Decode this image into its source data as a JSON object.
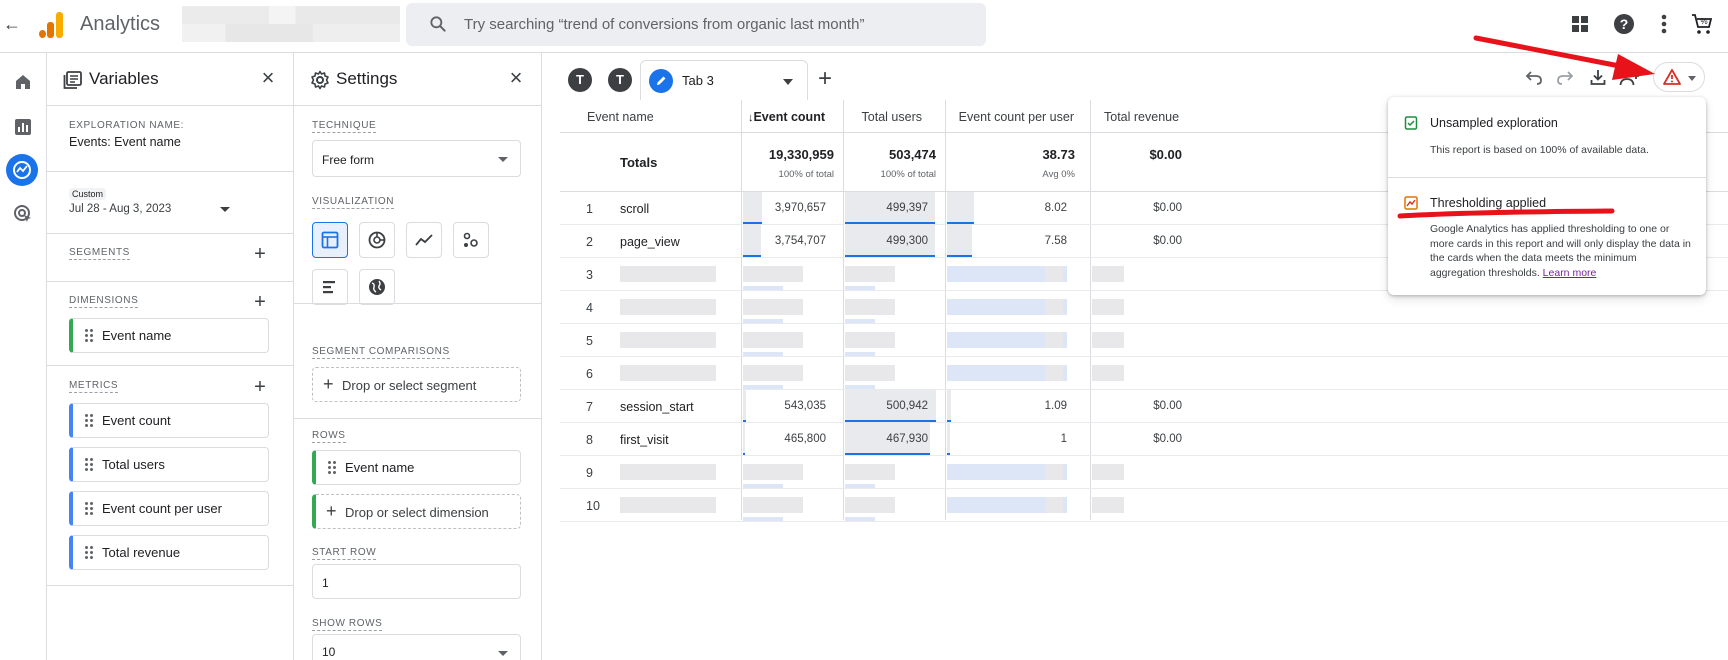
{
  "app": {
    "title": "Analytics",
    "search_placeholder": "Try searching “trend of conversions from organic last month”"
  },
  "variables_panel": {
    "title": "Variables",
    "exploration_name_label": "EXPLORATION NAME:",
    "exploration_name": "Events: Event name",
    "date_badge": "Custom",
    "date_range": "Jul 28 - Aug 3, 2023",
    "segments_label": "SEGMENTS",
    "dimensions_label": "DIMENSIONS",
    "dimensions": [
      "Event name"
    ],
    "metrics_label": "METRICS",
    "metrics": [
      "Event count",
      "Total users",
      "Event count per user",
      "Total revenue"
    ]
  },
  "settings_panel": {
    "title": "Settings",
    "technique_label": "TECHNIQUE",
    "technique_value": "Free form",
    "visualization_label": "VISUALIZATION",
    "segment_comparisons_label": "SEGMENT COMPARISONS",
    "drop_segment": "Drop or select segment",
    "rows_label": "ROWS",
    "rows_dimension": "Event name",
    "drop_dimension": "Drop or select dimension",
    "start_row_label": "START ROW",
    "start_row": "1",
    "show_rows_label": "SHOW ROWS",
    "show_rows": "10"
  },
  "tabs": {
    "tab1_initial": "T",
    "tab2_initial": "T",
    "active_label": "Tab 3"
  },
  "table": {
    "columns": [
      "Event name",
      "Event count",
      "Total users",
      "Event count per user",
      "Total revenue"
    ],
    "totals": {
      "label": "Totals",
      "event_count": "19,330,959",
      "event_count_sub": "100% of total",
      "total_users": "503,474",
      "total_users_sub": "100% of total",
      "per_user": "38.73",
      "per_user_sub": "Avg 0%",
      "revenue": "$0.00"
    },
    "rows": [
      {
        "n": "1",
        "name": "scroll",
        "event_count": "3,970,657",
        "total_users": "499,397",
        "per_user": "8.02",
        "revenue": "$0.00"
      },
      {
        "n": "2",
        "name": "page_view",
        "event_count": "3,754,707",
        "total_users": "499,300",
        "per_user": "7.58",
        "revenue": "$0.00"
      },
      {
        "n": "3"
      },
      {
        "n": "4"
      },
      {
        "n": "5"
      },
      {
        "n": "6"
      },
      {
        "n": "7",
        "name": "session_start",
        "event_count": "543,035",
        "total_users": "500,942",
        "per_user": "1.09",
        "revenue": "$0.00"
      },
      {
        "n": "8",
        "name": "first_visit",
        "event_count": "465,800",
        "total_users": "467,930",
        "per_user": "1",
        "revenue": "$0.00"
      },
      {
        "n": "9"
      },
      {
        "n": "10"
      }
    ],
    "bar_fractions": {
      "event_count": [
        0.205,
        0.194,
        null,
        null,
        null,
        null,
        0.028,
        0.024,
        null,
        null
      ],
      "total_users": [
        0.992,
        0.992,
        null,
        null,
        null,
        null,
        0.995,
        0.929,
        null,
        null
      ],
      "per_user": [
        0.21,
        0.196,
        null,
        null,
        null,
        null,
        0.028,
        0.026,
        null,
        null
      ]
    }
  },
  "popup": {
    "item1_title": "Unsampled exploration",
    "item1_desc": "This report is based on 100% of available data.",
    "item2_title": "Thresholding applied",
    "item2_desc": "Google Analytics has applied thresholding to one or more cards in this report and will only display the data in the cards when the data meets the minimum aggregation thresholds.",
    "item2_link": "Learn more"
  },
  "colors": {
    "brand_blue": "#1a73e8",
    "ga_orange": "#e37400",
    "ga_yellow": "#f9ab00",
    "annotation_red": "#e8131a",
    "dimension_green": "#34a853",
    "metric_blue": "#4285f4"
  },
  "icons": {
    "top_right": [
      "apps-icon",
      "help-icon",
      "more-vert-icon",
      "shopping-cart-icon"
    ],
    "rail": [
      "home-icon",
      "reports-icon",
      "explore-icon",
      "advertising-icon"
    ],
    "toolbar": [
      "undo-icon",
      "redo-icon",
      "download-icon",
      "share-icon",
      "warning-icon"
    ]
  }
}
